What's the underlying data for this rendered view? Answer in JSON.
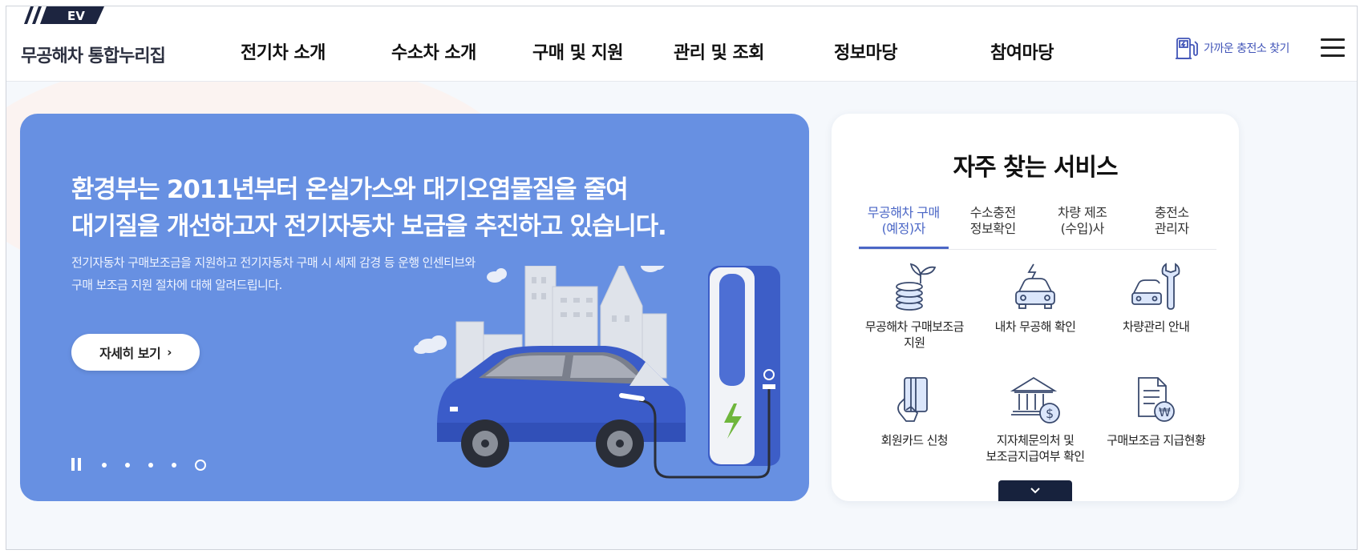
{
  "header": {
    "logo_tag": "EV",
    "logo_text": "무공해차 통합누리집",
    "nav": [
      "전기차 소개",
      "수소차 소개",
      "구매 및 지원",
      "관리 및 조회",
      "정보마당",
      "참여마당"
    ],
    "charger_link": "가까운 충전소 찾기",
    "menu_icon": "hamburger-icon"
  },
  "hero": {
    "title_line1": "환경부는 2011년부터 온실가스와 대기오염물질을 줄여",
    "title_line2": "대기질을 개선하고자 전기자동차 보급을 추진하고 있습니다.",
    "desc_line1": "전기자동차 구매보조금을 지원하고 전기자동차 구매 시 세제 감경 등 운행 인센티브와",
    "desc_line2": "구매 보조금 지원 절차에 대해 알려드립니다.",
    "button_label": "자세히 보기",
    "slides_total": 5,
    "active_slide": 5
  },
  "services": {
    "title": "자주 찾는 서비스",
    "tabs": [
      {
        "label": "무공해차 구매\n(예정)자",
        "active": true
      },
      {
        "label": "수소충전\n정보확인",
        "active": false
      },
      {
        "label": "차량 제조\n(수입)사",
        "active": false
      },
      {
        "label": "충전소\n관리자",
        "active": false
      }
    ],
    "items": [
      {
        "label": "무공해차 구매보조금\n지원",
        "icon": "coins-plant-icon"
      },
      {
        "label": "내차 무공해 확인",
        "icon": "electric-car-icon"
      },
      {
        "label": "차량관리 안내",
        "icon": "car-wrench-icon"
      },
      {
        "label": "회원카드 신청",
        "icon": "card-hand-icon"
      },
      {
        "label": "지자체문의처 및\n보조금지급여부 확인",
        "icon": "bank-dollar-icon"
      },
      {
        "label": "구매보조금 지급현황",
        "icon": "document-won-icon"
      }
    ]
  },
  "colors": {
    "hero_bg": "#6790e2",
    "accent": "#4b67c6",
    "icon_stroke": "#3a4a6e"
  }
}
